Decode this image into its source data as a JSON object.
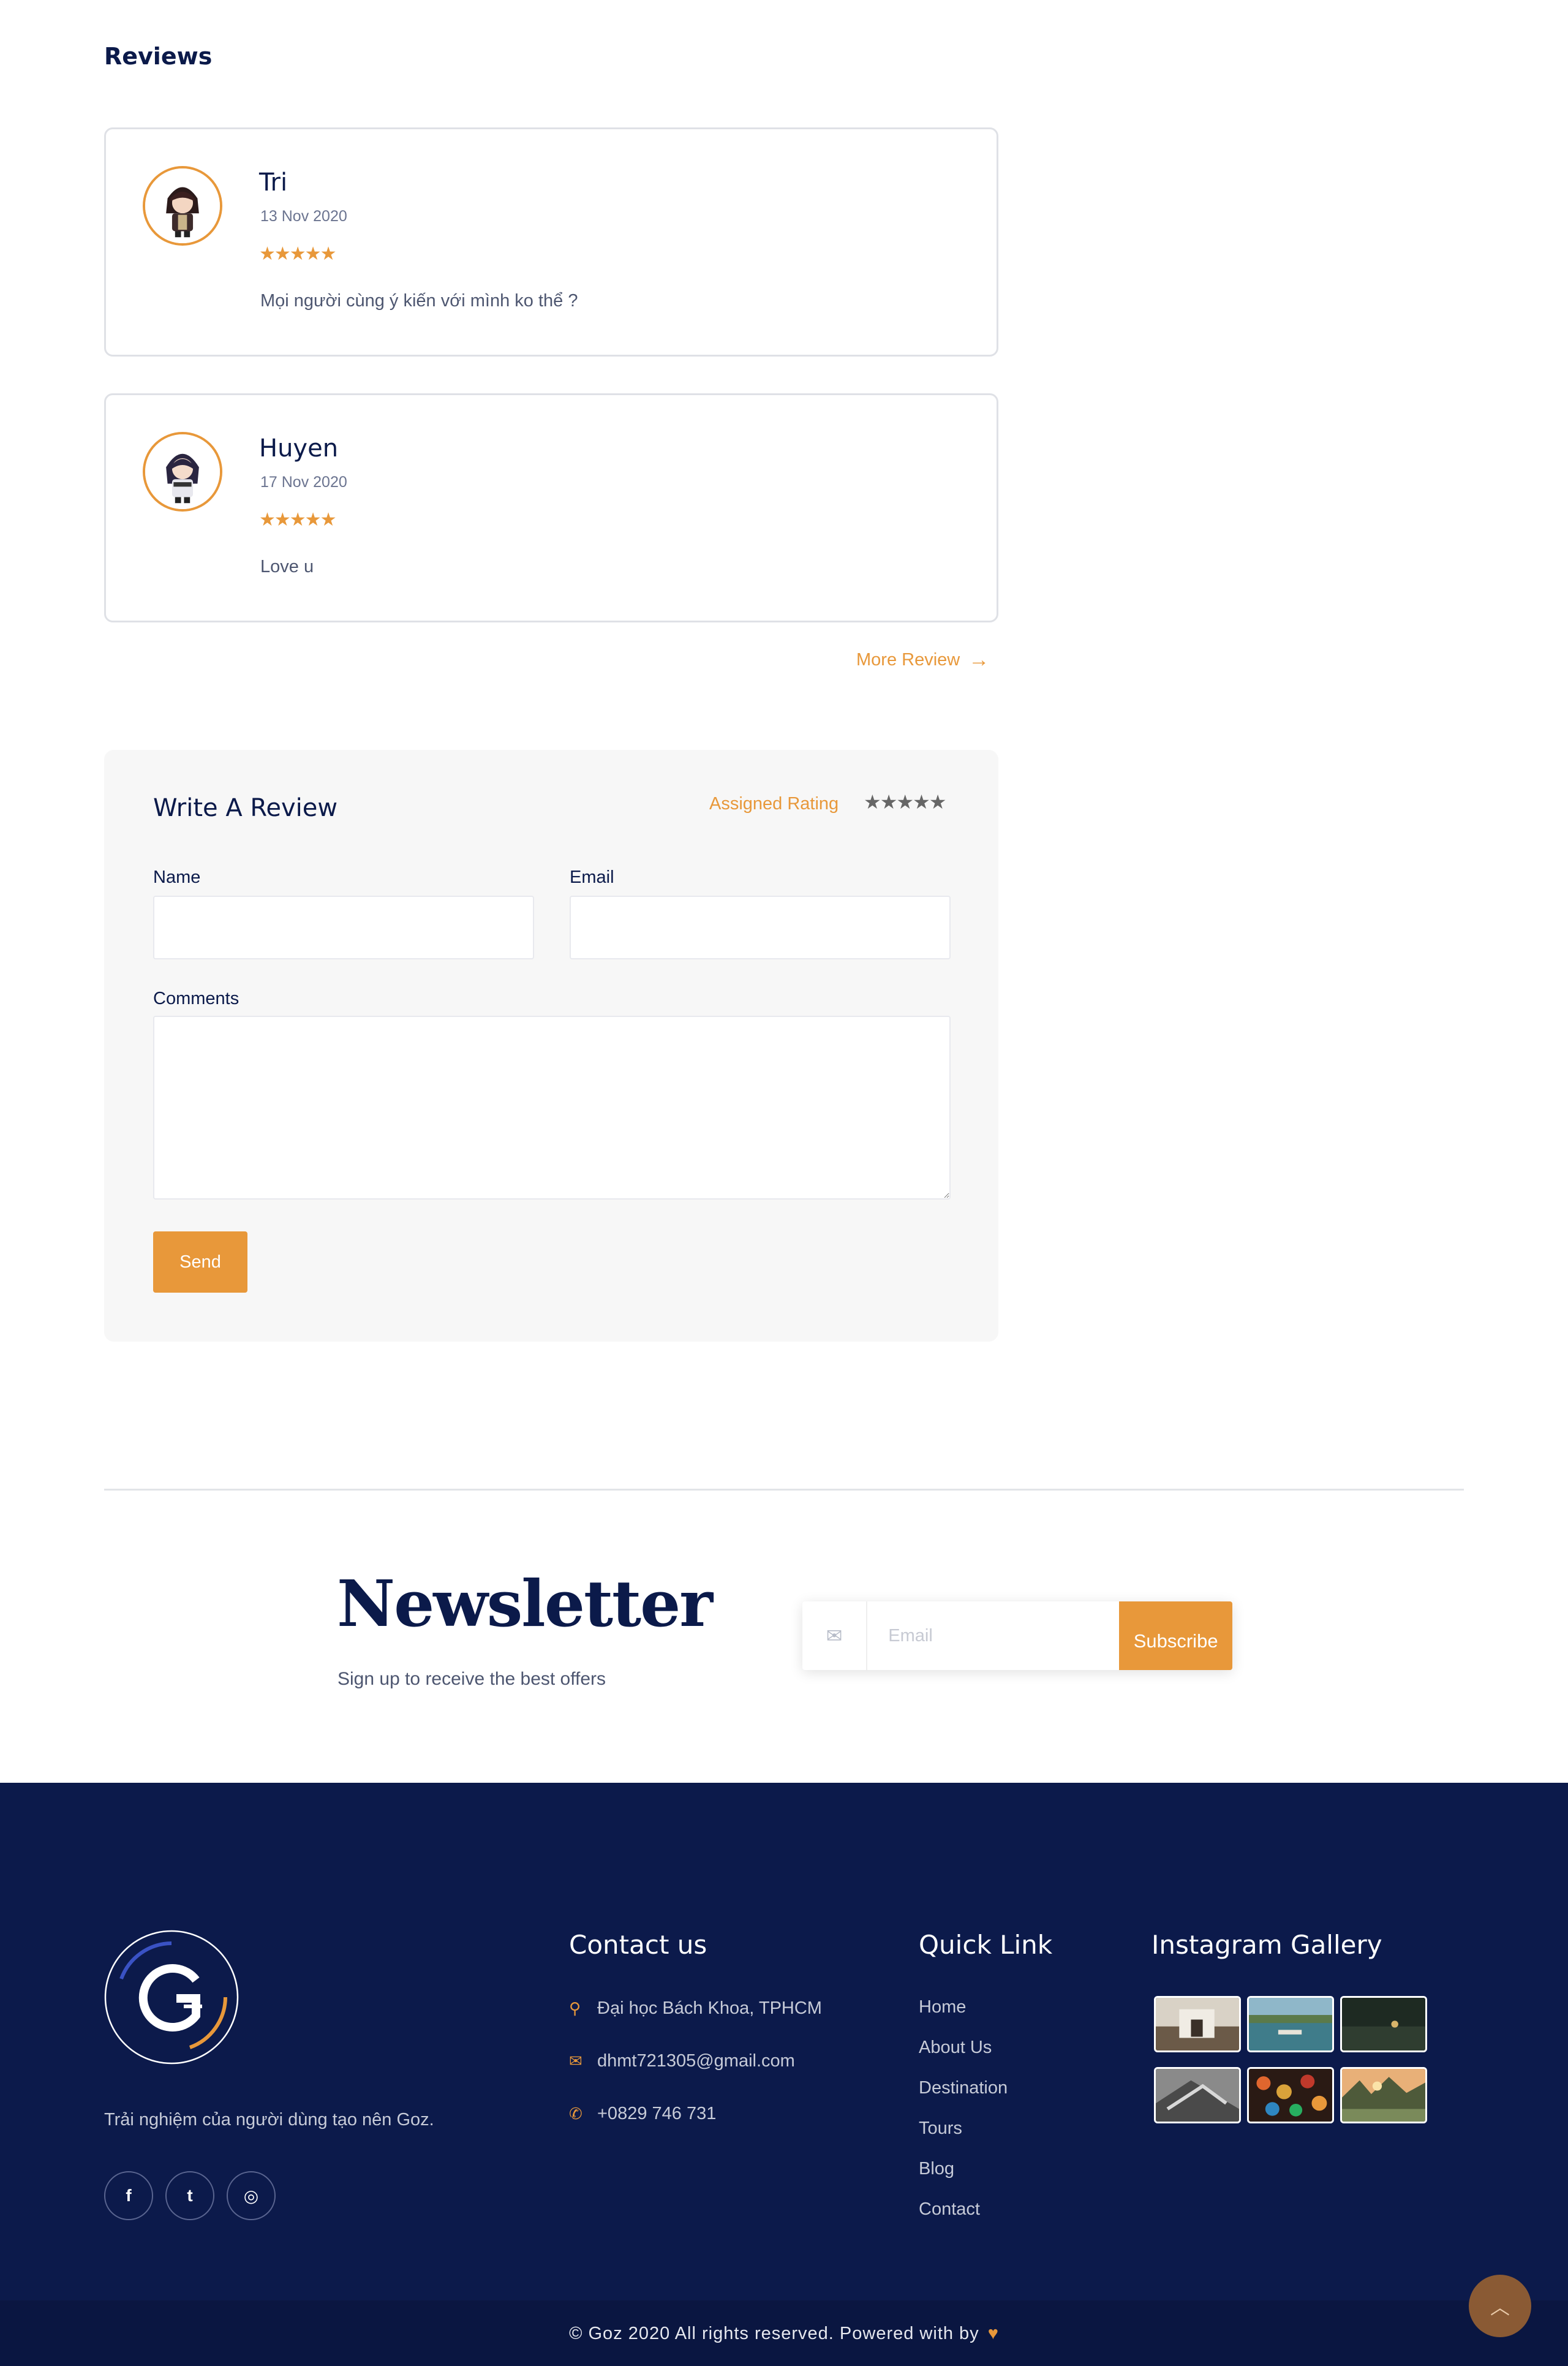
{
  "reviews": {
    "title": "Reviews",
    "items": [
      {
        "name": "Tri",
        "date": "13 Nov 2020",
        "stars": "★★★★★",
        "rating": 5,
        "comment": "Mọi người cùng ý kiến với mình ko thể ?"
      },
      {
        "name": "Huyen",
        "date": "17 Nov 2020",
        "stars": "★★★★★",
        "rating": 5,
        "comment": "Love u"
      }
    ],
    "more_label": "More Review",
    "more_icon": "arrow-right-icon"
  },
  "write_review": {
    "title": "Write A Review",
    "assigned_rating_label": "Assigned Rating",
    "assigned_stars": "★★★★★",
    "name_label": "Name",
    "name_value": "",
    "email_label": "Email",
    "email_value": "",
    "comments_label": "Comments",
    "comments_value": "",
    "send_label": "Send"
  },
  "newsletter": {
    "title": "Newsletter",
    "subtitle": "Sign up to receive the best offers",
    "email_placeholder": "Email",
    "email_icon": "envelope-icon",
    "subscribe_label": "Subscribe"
  },
  "footer": {
    "tagline": "Trải nghiệm của người dùng tạo nên Goz.",
    "social": [
      {
        "icon": "facebook-icon",
        "glyph": "f"
      },
      {
        "icon": "twitter-icon",
        "glyph": "t"
      },
      {
        "icon": "instagram-icon",
        "glyph": "◎"
      }
    ],
    "contact": {
      "title": "Contact us",
      "address": "Đại học Bách Khoa, TPHCM",
      "email": "dhmt721305@gmail.com",
      "phone": "+0829 746 731"
    },
    "quick_link": {
      "title": "Quick Link",
      "links": [
        "Home",
        "About Us",
        "Destination",
        "Tours",
        "Blog",
        "Contact"
      ]
    },
    "instagram": {
      "title": "Instagram Gallery"
    },
    "copyright": "© Goz 2020 All rights reserved. Powered with by"
  },
  "colors": {
    "accent": "#e8983a",
    "navy": "#0c1a4b",
    "text_muted": "#4d5670"
  }
}
